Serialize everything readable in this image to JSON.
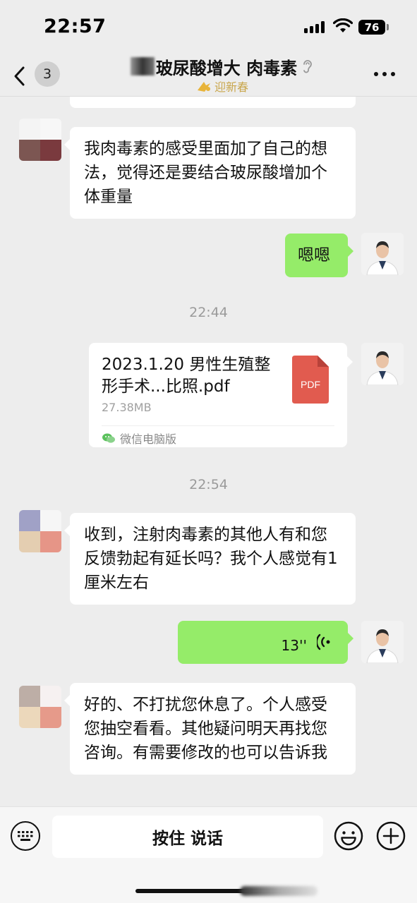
{
  "status_bar": {
    "time": "22:57",
    "battery": "76"
  },
  "nav": {
    "back_badge": "3",
    "title": "玻尿酸增大 肉毒素",
    "subtitle": "迎新春"
  },
  "messages": [
    {
      "type": "text",
      "side": "in",
      "text": "我肉毒素的感受里面加了自己的想法，觉得还是要结合玻尿酸增加个体重量"
    },
    {
      "type": "text",
      "side": "out",
      "text": "嗯嗯"
    },
    {
      "type": "time",
      "text": "22:44"
    },
    {
      "type": "file",
      "side": "out",
      "name": "2023.1.20 男性生殖整形手术...比照.pdf",
      "size": "27.38MB",
      "file_type": "PDF",
      "source": "微信电脑版"
    },
    {
      "type": "time",
      "text": "22:54"
    },
    {
      "type": "text",
      "side": "in",
      "text": "收到，注射肉毒素的其他人有和您反馈勃起有延长吗？我个人感觉有1厘米左右"
    },
    {
      "type": "voice",
      "side": "out",
      "duration": "13''"
    },
    {
      "type": "text",
      "side": "in",
      "text": "好的、不打扰您休息了。个人感受您抽空看看。其他疑问明天再找您咨询。有需要修改的也可以告诉我"
    }
  ],
  "input_bar": {
    "talk_label": "按住 说话"
  },
  "colors": {
    "background": "#ededed",
    "outgoing_bubble": "#95ec69",
    "incoming_bubble": "#ffffff",
    "pdf_icon": "#e15b4f",
    "subtitle": "#c9a64b"
  },
  "icons": {
    "back": "chevron-left-icon",
    "mute": "ear-icon",
    "more": "more-dots-icon",
    "file": "pdf-icon",
    "source": "wechat-icon",
    "voice": "voice-wave-icon",
    "keyboard": "keyboard-icon",
    "emoji": "emoji-icon",
    "plus": "plus-icon"
  }
}
